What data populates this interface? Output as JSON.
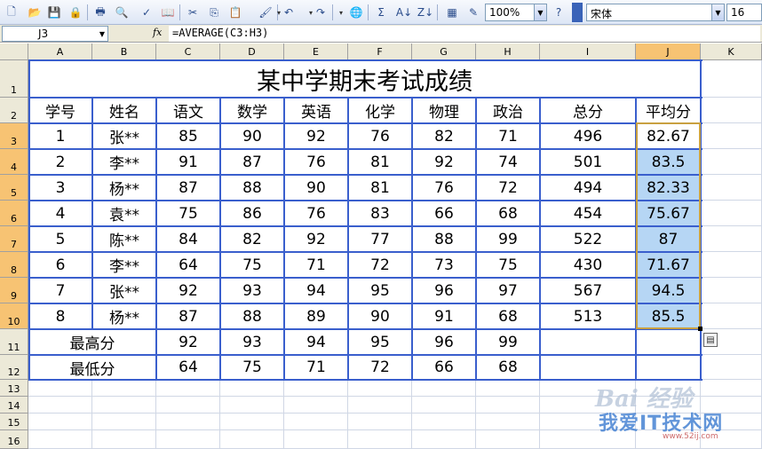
{
  "toolbar": {
    "zoom": "100%",
    "font_name": "宋体",
    "font_size": "16",
    "autosum_symbol": "Σ",
    "icons": [
      "new-icon",
      "open-icon",
      "save-icon",
      "permission-icon",
      "print-icon",
      "print-preview-icon",
      "spelling-icon",
      "research-icon",
      "cut-icon",
      "copy-icon",
      "paste-icon",
      "format-painter-icon",
      "undo-icon",
      "redo-icon",
      "hyperlink-icon",
      "autosum-icon",
      "sort-ascending-icon",
      "sort-descending-icon",
      "chart-wizard-icon",
      "drawing-icon",
      "help-icon"
    ]
  },
  "formula_bar": {
    "name_box": "J3",
    "fx": "fx",
    "formula": "=AVERAGE(C3:H3)"
  },
  "columns": [
    "A",
    "B",
    "C",
    "D",
    "E",
    "F",
    "G",
    "H",
    "I",
    "J",
    "K"
  ],
  "rows": [
    "1",
    "2",
    "3",
    "4",
    "5",
    "6",
    "7",
    "8",
    "9",
    "10",
    "11",
    "12",
    "13",
    "14",
    "15",
    "16"
  ],
  "sheet": {
    "title": "某中学期末考试成绩",
    "headers": [
      "学号",
      "姓名",
      "语文",
      "数学",
      "英语",
      "化学",
      "物理",
      "政治",
      "总分",
      "平均分"
    ],
    "students": [
      {
        "id": "1",
        "name": "张**",
        "scores": [
          "85",
          "90",
          "92",
          "76",
          "82",
          "71"
        ],
        "total": "496",
        "avg": "82.67"
      },
      {
        "id": "2",
        "name": "李**",
        "scores": [
          "91",
          "87",
          "76",
          "81",
          "92",
          "74"
        ],
        "total": "501",
        "avg": "83.5"
      },
      {
        "id": "3",
        "name": "杨**",
        "scores": [
          "87",
          "88",
          "90",
          "81",
          "76",
          "72"
        ],
        "total": "494",
        "avg": "82.33"
      },
      {
        "id": "4",
        "name": "袁**",
        "scores": [
          "75",
          "86",
          "76",
          "83",
          "66",
          "68"
        ],
        "total": "454",
        "avg": "75.67"
      },
      {
        "id": "5",
        "name": "陈**",
        "scores": [
          "84",
          "82",
          "92",
          "77",
          "88",
          "99"
        ],
        "total": "522",
        "avg": "87"
      },
      {
        "id": "6",
        "name": "李**",
        "scores": [
          "64",
          "75",
          "71",
          "72",
          "73",
          "75"
        ],
        "total": "430",
        "avg": "71.67"
      },
      {
        "id": "7",
        "name": "张**",
        "scores": [
          "92",
          "93",
          "94",
          "95",
          "96",
          "97"
        ],
        "total": "567",
        "avg": "94.5"
      },
      {
        "id": "8",
        "name": "杨**",
        "scores": [
          "87",
          "88",
          "89",
          "90",
          "91",
          "68"
        ],
        "total": "513",
        "avg": "85.5"
      }
    ],
    "max_row": {
      "label": "最高分",
      "values": [
        "92",
        "93",
        "94",
        "95",
        "96",
        "99"
      ]
    },
    "min_row": {
      "label": "最低分",
      "values": [
        "64",
        "75",
        "71",
        "72",
        "66",
        "68"
      ]
    }
  },
  "watermark": {
    "brand": "Bai 经验",
    "site": "我爱IT技术网",
    "url": "www.52ij.com"
  }
}
